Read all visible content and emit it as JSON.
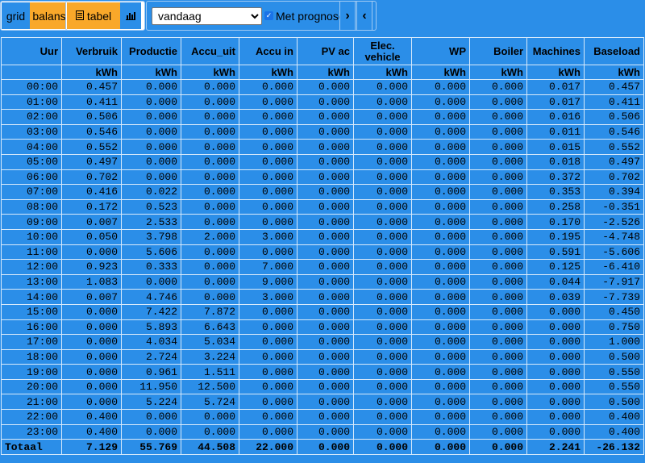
{
  "toolbar": {
    "grid_label": "grid",
    "balans_label": "balans",
    "tabel_label": "tabel",
    "chart_icon": "bar-chart-icon",
    "table_icon": "table-icon",
    "period_value": "vandaag",
    "prognose_label": "Met prognose",
    "prognose_checked": true,
    "next_icon": "chevron-right-icon",
    "prev_icon": "chevron-left-icon"
  },
  "table": {
    "headers": [
      "Uur",
      "Verbruik",
      "Productie",
      "Accu_uit",
      "Accu in",
      "PV ac",
      "Elec. vehicle",
      "WP",
      "Boiler",
      "Machines",
      "Baseload"
    ],
    "units": [
      "",
      "kWh",
      "kWh",
      "kWh",
      "kWh",
      "kWh",
      "kWh",
      "kWh",
      "kWh",
      "kWh",
      "kWh"
    ],
    "rows": [
      [
        "00:00",
        "0.457",
        "0.000",
        "0.000",
        "0.000",
        "0.000",
        "0.000",
        "0.000",
        "0.000",
        "0.017",
        "0.457"
      ],
      [
        "01:00",
        "0.411",
        "0.000",
        "0.000",
        "0.000",
        "0.000",
        "0.000",
        "0.000",
        "0.000",
        "0.017",
        "0.411"
      ],
      [
        "02:00",
        "0.506",
        "0.000",
        "0.000",
        "0.000",
        "0.000",
        "0.000",
        "0.000",
        "0.000",
        "0.016",
        "0.506"
      ],
      [
        "03:00",
        "0.546",
        "0.000",
        "0.000",
        "0.000",
        "0.000",
        "0.000",
        "0.000",
        "0.000",
        "0.011",
        "0.546"
      ],
      [
        "04:00",
        "0.552",
        "0.000",
        "0.000",
        "0.000",
        "0.000",
        "0.000",
        "0.000",
        "0.000",
        "0.015",
        "0.552"
      ],
      [
        "05:00",
        "0.497",
        "0.000",
        "0.000",
        "0.000",
        "0.000",
        "0.000",
        "0.000",
        "0.000",
        "0.018",
        "0.497"
      ],
      [
        "06:00",
        "0.702",
        "0.000",
        "0.000",
        "0.000",
        "0.000",
        "0.000",
        "0.000",
        "0.000",
        "0.372",
        "0.702"
      ],
      [
        "07:00",
        "0.416",
        "0.022",
        "0.000",
        "0.000",
        "0.000",
        "0.000",
        "0.000",
        "0.000",
        "0.353",
        "0.394"
      ],
      [
        "08:00",
        "0.172",
        "0.523",
        "0.000",
        "0.000",
        "0.000",
        "0.000",
        "0.000",
        "0.000",
        "0.258",
        "-0.351"
      ],
      [
        "09:00",
        "0.007",
        "2.533",
        "0.000",
        "0.000",
        "0.000",
        "0.000",
        "0.000",
        "0.000",
        "0.170",
        "-2.526"
      ],
      [
        "10:00",
        "0.050",
        "3.798",
        "2.000",
        "3.000",
        "0.000",
        "0.000",
        "0.000",
        "0.000",
        "0.195",
        "-4.748"
      ],
      [
        "11:00",
        "0.000",
        "5.606",
        "0.000",
        "0.000",
        "0.000",
        "0.000",
        "0.000",
        "0.000",
        "0.591",
        "-5.606"
      ],
      [
        "12:00",
        "0.923",
        "0.333",
        "0.000",
        "7.000",
        "0.000",
        "0.000",
        "0.000",
        "0.000",
        "0.125",
        "-6.410"
      ],
      [
        "13:00",
        "1.083",
        "0.000",
        "0.000",
        "9.000",
        "0.000",
        "0.000",
        "0.000",
        "0.000",
        "0.044",
        "-7.917"
      ],
      [
        "14:00",
        "0.007",
        "4.746",
        "0.000",
        "3.000",
        "0.000",
        "0.000",
        "0.000",
        "0.000",
        "0.039",
        "-7.739"
      ],
      [
        "15:00",
        "0.000",
        "7.422",
        "7.872",
        "0.000",
        "0.000",
        "0.000",
        "0.000",
        "0.000",
        "0.000",
        "0.450"
      ],
      [
        "16:00",
        "0.000",
        "5.893",
        "6.643",
        "0.000",
        "0.000",
        "0.000",
        "0.000",
        "0.000",
        "0.000",
        "0.750"
      ],
      [
        "17:00",
        "0.000",
        "4.034",
        "5.034",
        "0.000",
        "0.000",
        "0.000",
        "0.000",
        "0.000",
        "0.000",
        "1.000"
      ],
      [
        "18:00",
        "0.000",
        "2.724",
        "3.224",
        "0.000",
        "0.000",
        "0.000",
        "0.000",
        "0.000",
        "0.000",
        "0.500"
      ],
      [
        "19:00",
        "0.000",
        "0.961",
        "1.511",
        "0.000",
        "0.000",
        "0.000",
        "0.000",
        "0.000",
        "0.000",
        "0.550"
      ],
      [
        "20:00",
        "0.000",
        "11.950",
        "12.500",
        "0.000",
        "0.000",
        "0.000",
        "0.000",
        "0.000",
        "0.000",
        "0.550"
      ],
      [
        "21:00",
        "0.000",
        "5.224",
        "5.724",
        "0.000",
        "0.000",
        "0.000",
        "0.000",
        "0.000",
        "0.000",
        "0.500"
      ],
      [
        "22:00",
        "0.400",
        "0.000",
        "0.000",
        "0.000",
        "0.000",
        "0.000",
        "0.000",
        "0.000",
        "0.000",
        "0.400"
      ],
      [
        "23:00",
        "0.400",
        "0.000",
        "0.000",
        "0.000",
        "0.000",
        "0.000",
        "0.000",
        "0.000",
        "0.000",
        "0.400"
      ]
    ],
    "totals": [
      "Totaal",
      "7.129",
      "55.769",
      "44.508",
      "22.000",
      "0.000",
      "0.000",
      "0.000",
      "0.000",
      "2.241",
      "-26.132"
    ]
  }
}
